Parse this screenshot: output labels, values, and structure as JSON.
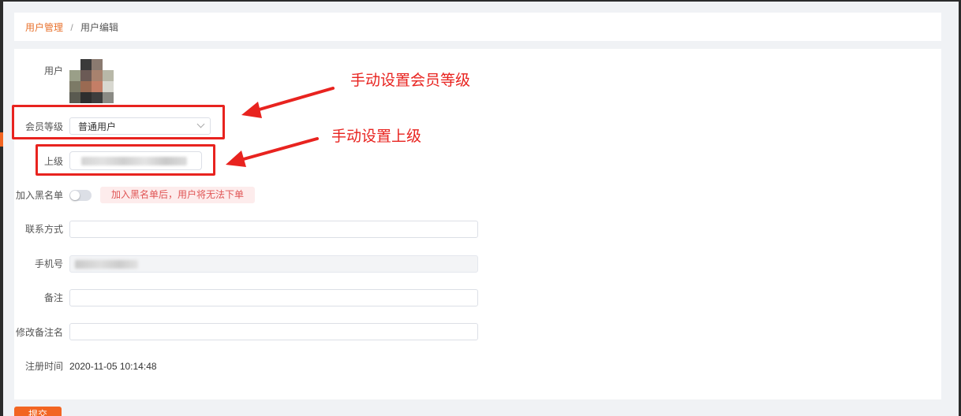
{
  "breadcrumb": {
    "parent": "用户管理",
    "separator": "/",
    "current": "用户编辑"
  },
  "form": {
    "user_label": "用户",
    "member_level_label": "会员等级",
    "member_level_value": "普通用户",
    "superior_label": "上级",
    "blacklist_label": "加入黑名单",
    "blacklist_on": false,
    "blacklist_tip": "加入黑名单后，用户将无法下单",
    "contact_label": "联系方式",
    "contact_value": "",
    "phone_label": "手机号",
    "remark_label": "备注",
    "remark_value": "",
    "remark_name_label": "修改备注名",
    "remark_name_value": "",
    "register_time_label": "注册时间",
    "register_time_value": "2020-11-05 10:14:48"
  },
  "actions": {
    "submit_label": "提交"
  },
  "annotations": {
    "level_note": "手动设置会员等级",
    "superior_note": "手动设置上级"
  },
  "colors": {
    "accent": "#f26522",
    "annotation": "#e8231f",
    "tip_bg": "#fdecec",
    "tip_text": "#e05656"
  }
}
